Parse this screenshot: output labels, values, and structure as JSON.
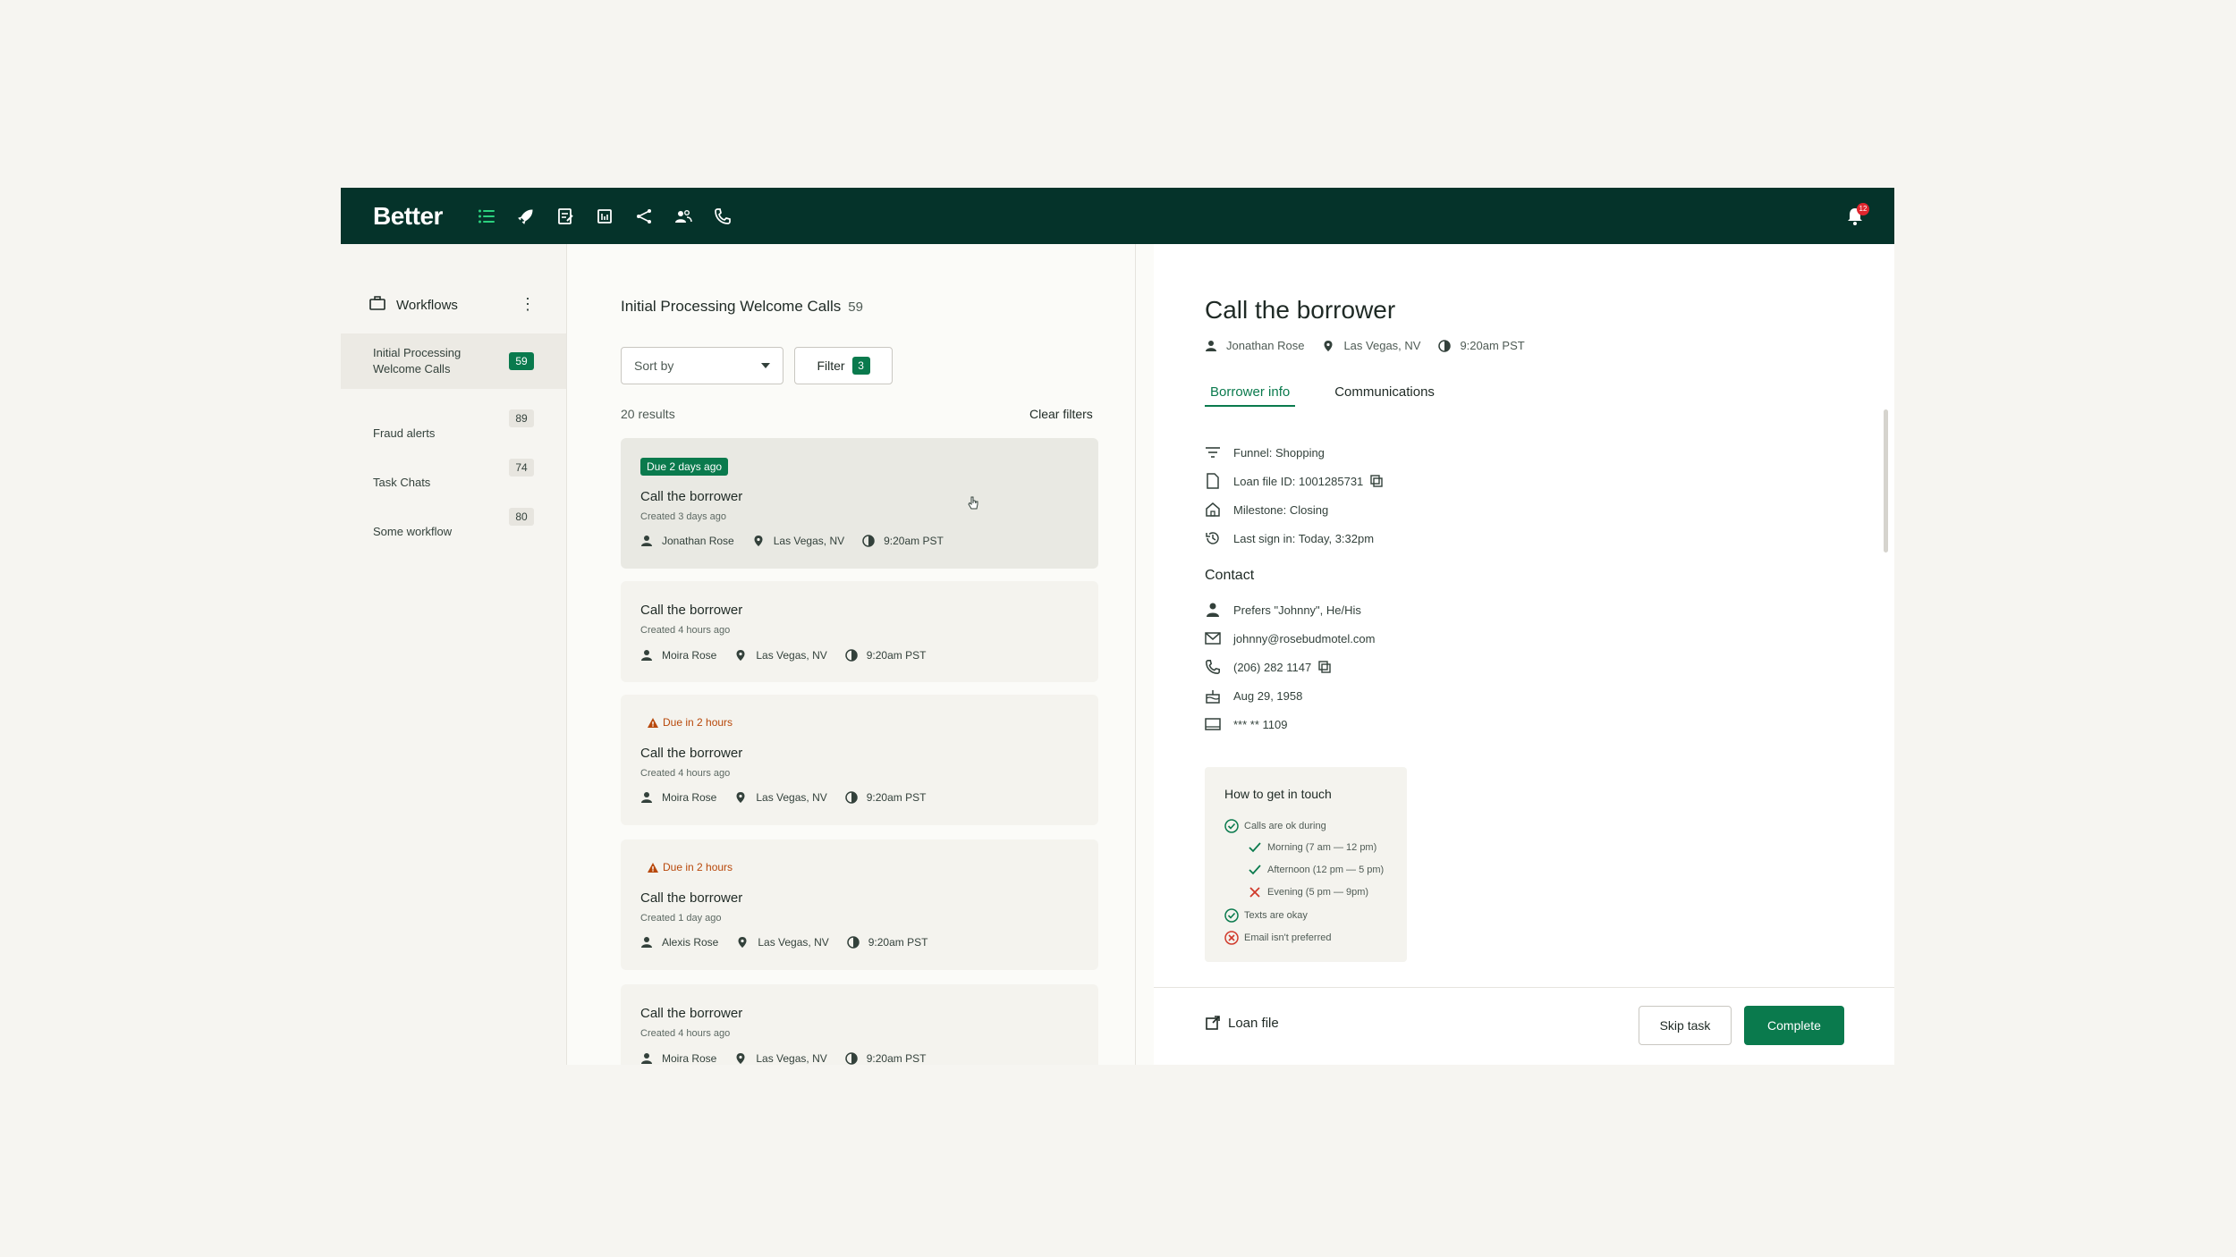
{
  "app": {
    "brand": "Better",
    "notification_count": "12"
  },
  "colors": {
    "topbar": "#05332a",
    "accent": "#0a7a4d",
    "warning": "#b8480a",
    "error": "#d03a2b"
  },
  "nav": {
    "icons": [
      "list-icon",
      "rocket-icon",
      "checklist-icon",
      "calculator-icon",
      "share-icon",
      "users-icon",
      "phone-icon"
    ]
  },
  "sidebar": {
    "header": "Workflows",
    "items": [
      {
        "label_line1": "Initial Processing",
        "label_line2": "Welcome Calls",
        "count": "59"
      },
      {
        "label": "Fraud alerts",
        "count": "89"
      },
      {
        "label": "Task Chats",
        "count": "74"
      },
      {
        "label": "Some workflow",
        "count": "80"
      }
    ]
  },
  "list": {
    "title": "Initial Processing Welcome Calls",
    "count": "59",
    "sort_label": "Sort by",
    "filter_label": "Filter",
    "filter_count": "3",
    "results": "20 results",
    "clear_filters": "Clear filters",
    "cards": [
      {
        "due": "Due 2 days ago",
        "title": "Call the borrower",
        "created": "Created 3 days ago",
        "person": "Jonathan Rose",
        "location": "Las Vegas, NV",
        "time": "9:20am PST"
      },
      {
        "title": "Call the borrower",
        "created": "Created 4 hours ago",
        "person": "Moira Rose",
        "location": "Las Vegas, NV",
        "time": "9:20am PST"
      },
      {
        "due": "Due in 2 hours",
        "title": "Call the borrower",
        "created": "Created 4 hours ago",
        "person": "Moira Rose",
        "location": "Las Vegas, NV",
        "time": "9:20am PST"
      },
      {
        "due": "Due in 2 hours",
        "title": "Call the borrower",
        "created": "Created 1 day ago",
        "person": "Alexis Rose",
        "location": "Las Vegas, NV",
        "time": "9:20am PST"
      },
      {
        "title": "Call the borrower",
        "created": "Created 4 hours ago",
        "person": "Moira Rose",
        "location": "Las Vegas, NV",
        "time": "9:20am PST"
      }
    ]
  },
  "detail": {
    "title": "Call the borrower",
    "person": "Jonathan Rose",
    "location": "Las Vegas, NV",
    "time": "9:20am PST",
    "tabs": [
      "Borrower info",
      "Communications"
    ],
    "info": {
      "funnel": "Funnel: Shopping",
      "loan_id": "Loan file ID: 1001285731",
      "milestone": "Milestone: Closing",
      "last_sign_in": "Last sign in: Today, 3:32pm"
    },
    "contact_header": "Contact",
    "contact": {
      "prefers": "Prefers \"Johnny\", He/His",
      "email": "johnny@rosebudmotel.com",
      "phone": "(206) 282 1147",
      "dob": "Aug 29, 1958",
      "ssn": "*** ** 1109"
    },
    "touch": {
      "title": "How to get in touch",
      "calls": "Calls are ok during",
      "morning": "Morning (7 am — 12 pm)",
      "afternoon": "Afternoon (12 pm — 5 pm)",
      "evening": "Evening (5 pm — 9pm)",
      "texts": "Texts are okay",
      "email": "Email isn't preferred"
    },
    "footer": {
      "loan_file": "Loan file",
      "skip": "Skip task",
      "complete": "Complete"
    }
  }
}
